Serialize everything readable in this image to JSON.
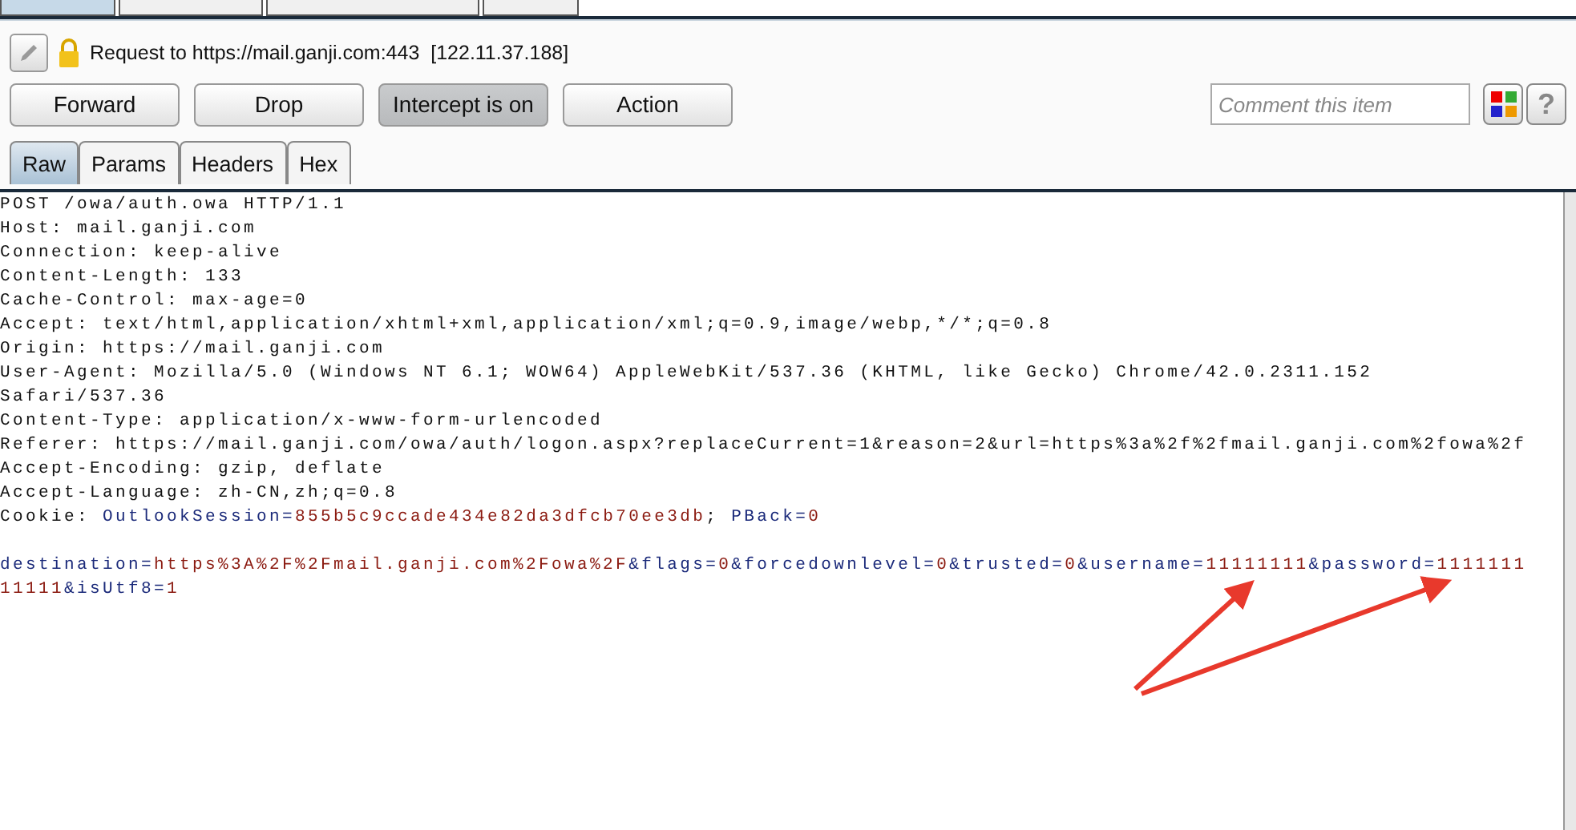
{
  "top_tabs": [
    {
      "selected": true
    },
    {
      "selected": false
    },
    {
      "selected": false
    },
    {
      "selected": false
    }
  ],
  "request_info": {
    "text": "Request to https://mail.ganji.com:443  [122.11.37.188]"
  },
  "buttons": [
    {
      "label": "Forward",
      "selected": false
    },
    {
      "label": "Drop",
      "selected": false
    },
    {
      "label": "Intercept is on",
      "selected": true
    },
    {
      "label": "Action",
      "selected": false
    }
  ],
  "comment": {
    "placeholder": "Comment this item"
  },
  "help_button": {
    "label": "?"
  },
  "view_tabs": [
    {
      "label": "Raw",
      "selected": true
    },
    {
      "label": "Params",
      "selected": false
    },
    {
      "label": "Headers",
      "selected": false
    },
    {
      "label": "Hex",
      "selected": false
    }
  ],
  "lines": [
    [
      {
        "kind": "plain",
        "text": "POST /owa/auth.owa HTTP/1.1"
      }
    ],
    [
      {
        "kind": "plain",
        "text": "Host: mail.ganji.com"
      }
    ],
    [
      {
        "kind": "plain",
        "text": "Connection: keep-alive"
      }
    ],
    [
      {
        "kind": "plain",
        "text": "Content-Length: 133"
      }
    ],
    [
      {
        "kind": "plain",
        "text": "Cache-Control: max-age=0"
      }
    ],
    [
      {
        "kind": "plain",
        "text": "Accept: text/html,application/xhtml+xml,application/xml;q=0.9,image/webp,*/*;q=0.8"
      }
    ],
    [
      {
        "kind": "plain",
        "text": "Origin: https://mail.ganji.com"
      }
    ],
    [
      {
        "kind": "plain",
        "text": "User-Agent: Mozilla/5.0 (Windows NT 6.1; WOW64) AppleWebKit/537.36 (KHTML, like Gecko) Chrome/42.0.2311.152"
      }
    ],
    [
      {
        "kind": "plain",
        "text": "Safari/537.36"
      }
    ],
    [
      {
        "kind": "plain",
        "text": "Content-Type: application/x-www-form-urlencoded"
      }
    ],
    [
      {
        "kind": "plain",
        "text": "Referer: https://mail.ganji.com/owa/auth/logon.aspx?replaceCurrent=1&reason=2&url=https%3a%2f%2fmail.ganji.com%2fowa%2f"
      }
    ],
    [
      {
        "kind": "plain",
        "text": "Accept-Encoding: gzip, deflate"
      }
    ],
    [
      {
        "kind": "plain",
        "text": "Accept-Language: zh-CN,zh;q=0.8"
      }
    ],
    [
      {
        "kind": "plain",
        "text": "Cookie: "
      },
      {
        "kind": "name",
        "text": "OutlookSession"
      },
      {
        "kind": "name",
        "text": "="
      },
      {
        "kind": "value",
        "text": "855b5c9ccade434e82da3dfcb70ee3db"
      },
      {
        "kind": "plain",
        "text": "; "
      },
      {
        "kind": "name",
        "text": "PBack"
      },
      {
        "kind": "name",
        "text": "="
      },
      {
        "kind": "value",
        "text": "0"
      }
    ]
  ],
  "body": [
    [
      {
        "kind": "name",
        "text": "destination="
      },
      {
        "kind": "value",
        "text": "https%3A%2F%2Fmail.ganji.com%2Fowa%2F"
      },
      {
        "kind": "name",
        "text": "&flags="
      },
      {
        "kind": "value",
        "text": "0"
      },
      {
        "kind": "name",
        "text": "&forcedownlevel="
      },
      {
        "kind": "value",
        "text": "0"
      },
      {
        "kind": "name",
        "text": "&trusted="
      },
      {
        "kind": "value",
        "text": "0"
      },
      {
        "kind": "name",
        "text": "&username="
      },
      {
        "kind": "value",
        "text": "11111111"
      },
      {
        "kind": "name",
        "text": "&password="
      },
      {
        "kind": "value",
        "text": "1111111"
      }
    ],
    [
      {
        "kind": "value",
        "text": "11111"
      },
      {
        "kind": "name",
        "text": "&isUtf8="
      },
      {
        "kind": "value",
        "text": "1"
      }
    ]
  ]
}
